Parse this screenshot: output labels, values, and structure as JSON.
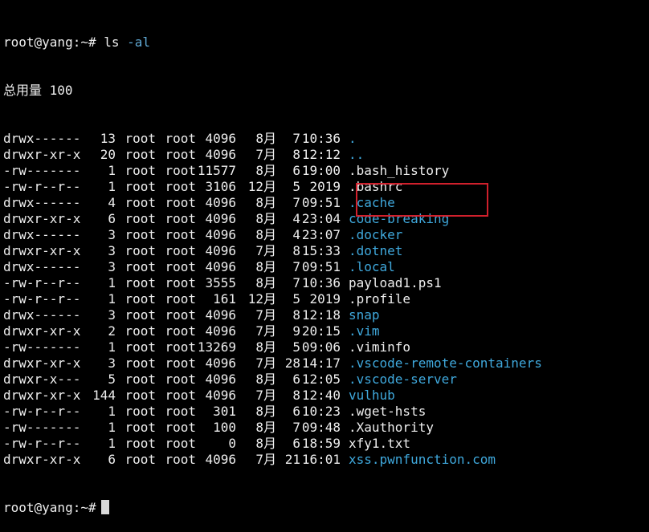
{
  "terminal": {
    "prompt": "root@yang:~#",
    "command": "ls",
    "command_args": "-al",
    "total_line": "总用量 100",
    "entries": [
      {
        "perm": "drwx------",
        "links": "13",
        "owner": "root",
        "group": "root",
        "size": "4096",
        "month": "8月",
        "day": "7",
        "time": "10:36",
        "name": ".",
        "type": "dir"
      },
      {
        "perm": "drwxr-xr-x",
        "links": "20",
        "owner": "root",
        "group": "root",
        "size": "4096",
        "month": "7月",
        "day": "8",
        "time": "12:12",
        "name": "..",
        "type": "dir"
      },
      {
        "perm": "-rw-------",
        "links": "1",
        "owner": "root",
        "group": "root",
        "size": "11577",
        "month": "8月",
        "day": "6",
        "time": "19:00",
        "name": ".bash_history",
        "type": "file"
      },
      {
        "perm": "-rw-r--r--",
        "links": "1",
        "owner": "root",
        "group": "root",
        "size": "3106",
        "month": "12月",
        "day": "5",
        "time": "2019",
        "name": ".bashrc",
        "type": "file"
      },
      {
        "perm": "drwx------",
        "links": "4",
        "owner": "root",
        "group": "root",
        "size": "4096",
        "month": "8月",
        "day": "7",
        "time": "09:51",
        "name": ".cache",
        "type": "dir"
      },
      {
        "perm": "drwxr-xr-x",
        "links": "6",
        "owner": "root",
        "group": "root",
        "size": "4096",
        "month": "8月",
        "day": "4",
        "time": "23:04",
        "name": "code-breaking",
        "type": "dir"
      },
      {
        "perm": "drwx------",
        "links": "3",
        "owner": "root",
        "group": "root",
        "size": "4096",
        "month": "8月",
        "day": "4",
        "time": "23:07",
        "name": ".docker",
        "type": "dir"
      },
      {
        "perm": "drwxr-xr-x",
        "links": "3",
        "owner": "root",
        "group": "root",
        "size": "4096",
        "month": "7月",
        "day": "8",
        "time": "15:33",
        "name": ".dotnet",
        "type": "dir"
      },
      {
        "perm": "drwx------",
        "links": "3",
        "owner": "root",
        "group": "root",
        "size": "4096",
        "month": "8月",
        "day": "7",
        "time": "09:51",
        "name": ".local",
        "type": "dir"
      },
      {
        "perm": "-rw-r--r--",
        "links": "1",
        "owner": "root",
        "group": "root",
        "size": "3555",
        "month": "8月",
        "day": "7",
        "time": "10:36",
        "name": "payload1.ps1",
        "type": "file"
      },
      {
        "perm": "-rw-r--r--",
        "links": "1",
        "owner": "root",
        "group": "root",
        "size": "161",
        "month": "12月",
        "day": "5",
        "time": "2019",
        "name": ".profile",
        "type": "file"
      },
      {
        "perm": "drwx------",
        "links": "3",
        "owner": "root",
        "group": "root",
        "size": "4096",
        "month": "7月",
        "day": "8",
        "time": "12:18",
        "name": "snap",
        "type": "dir"
      },
      {
        "perm": "drwxr-xr-x",
        "links": "2",
        "owner": "root",
        "group": "root",
        "size": "4096",
        "month": "7月",
        "day": "9",
        "time": "20:15",
        "name": ".vim",
        "type": "dir"
      },
      {
        "perm": "-rw-------",
        "links": "1",
        "owner": "root",
        "group": "root",
        "size": "13269",
        "month": "8月",
        "day": "5",
        "time": "09:06",
        "name": ".viminfo",
        "type": "file"
      },
      {
        "perm": "drwxr-xr-x",
        "links": "3",
        "owner": "root",
        "group": "root",
        "size": "4096",
        "month": "7月",
        "day": "28",
        "time": "14:17",
        "name": ".vscode-remote-containers",
        "type": "dir"
      },
      {
        "perm": "drwxr-x---",
        "links": "5",
        "owner": "root",
        "group": "root",
        "size": "4096",
        "month": "8月",
        "day": "6",
        "time": "12:05",
        "name": ".vscode-server",
        "type": "dir"
      },
      {
        "perm": "drwxr-xr-x",
        "links": "144",
        "owner": "root",
        "group": "root",
        "size": "4096",
        "month": "7月",
        "day": "8",
        "time": "12:40",
        "name": "vulhub",
        "type": "dir"
      },
      {
        "perm": "-rw-r--r--",
        "links": "1",
        "owner": "root",
        "group": "root",
        "size": "301",
        "month": "8月",
        "day": "6",
        "time": "10:23",
        "name": ".wget-hsts",
        "type": "file"
      },
      {
        "perm": "-rw-------",
        "links": "1",
        "owner": "root",
        "group": "root",
        "size": "100",
        "month": "8月",
        "day": "7",
        "time": "09:48",
        "name": ".Xauthority",
        "type": "file"
      },
      {
        "perm": "-rw-r--r--",
        "links": "1",
        "owner": "root",
        "group": "root",
        "size": "0",
        "month": "8月",
        "day": "6",
        "time": "18:59",
        "name": "xfy1.txt",
        "type": "file"
      },
      {
        "perm": "drwxr-xr-x",
        "links": "6",
        "owner": "root",
        "group": "root",
        "size": "4096",
        "month": "7月",
        "day": "21",
        "time": "16:01",
        "name": "xss.pwnfunction.com",
        "type": "dir"
      }
    ],
    "colors": {
      "background": "#000000",
      "text": "#eeeeee",
      "directory": "#3fa8dc",
      "highlight_box": "#d0202c"
    }
  }
}
